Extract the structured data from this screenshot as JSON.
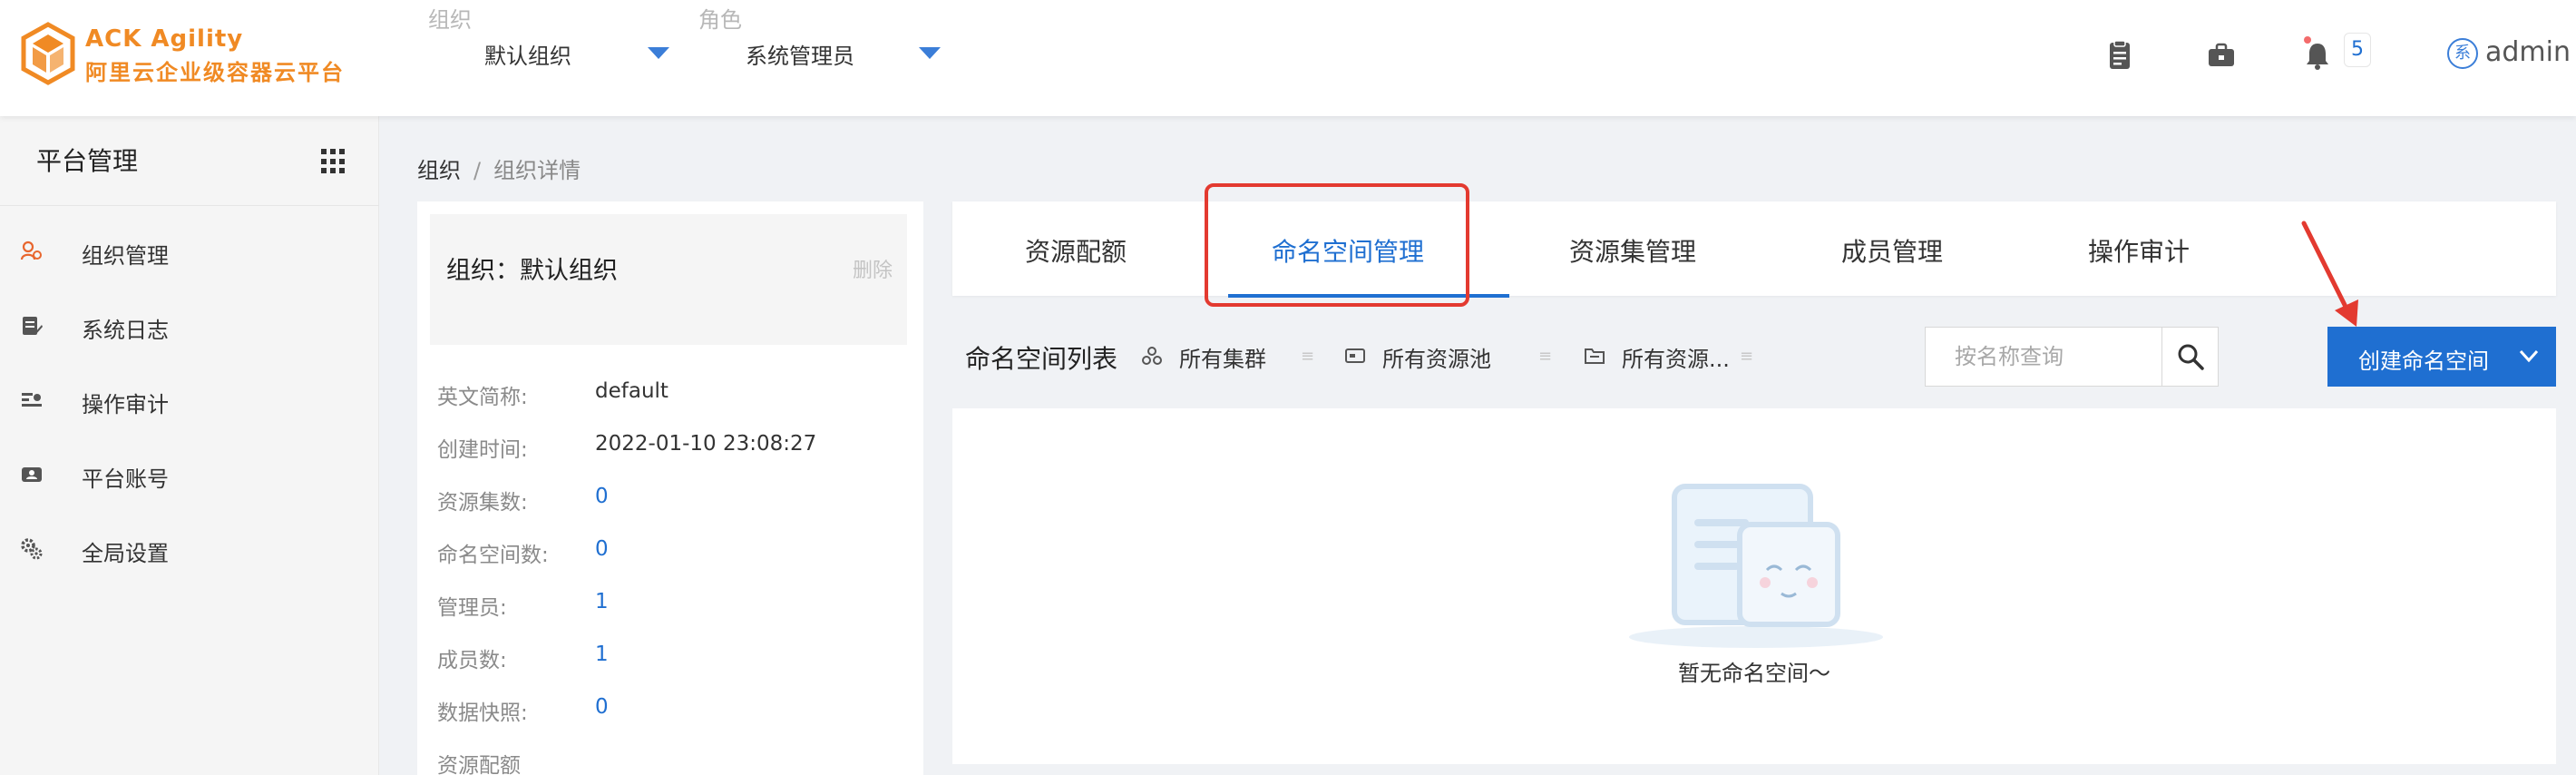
{
  "brand": {
    "name": "ACK  Agility",
    "subtitle": "阿里云企业级容器云平台",
    "accent_color": "#f08a24"
  },
  "header": {
    "org_selector": {
      "caption": "组织",
      "value": "默认组织"
    },
    "role_selector": {
      "caption": "角色",
      "value": "系统管理员"
    },
    "icons": [
      "clipboard-icon",
      "briefcase-icon",
      "bell-icon"
    ],
    "notification_count": "5",
    "user": {
      "avatar_text": "系",
      "name": "admin"
    }
  },
  "sidebar": {
    "title": "平台管理",
    "items": [
      {
        "label": "组织管理",
        "icon": "org-people-icon"
      },
      {
        "label": "系统日志",
        "icon": "log-icon"
      },
      {
        "label": "操作审计",
        "icon": "audit-icon"
      },
      {
        "label": "平台账号",
        "icon": "account-icon"
      },
      {
        "label": "全局设置",
        "icon": "settings-icon"
      }
    ]
  },
  "breadcrumb": {
    "root": "组织",
    "separator": "/",
    "current": "组织详情"
  },
  "org_info": {
    "title": "组织：默认组织",
    "delete_label": "删除",
    "fields": [
      {
        "key": "英文简称:",
        "value": "default",
        "highlight": false
      },
      {
        "key": "创建时间:",
        "value": "2022-01-10 23:08:27",
        "highlight": false
      },
      {
        "key": "资源集数:",
        "value": "0",
        "highlight": true
      },
      {
        "key": "命名空间数:",
        "value": "0",
        "highlight": true
      },
      {
        "key": "管理员:",
        "value": "1",
        "highlight": true
      },
      {
        "key": "成员数:",
        "value": "1",
        "highlight": true
      },
      {
        "key": "数据快照:",
        "value": "0",
        "highlight": true
      },
      {
        "key": "资源配额",
        "value": "",
        "highlight": false
      }
    ]
  },
  "tabs": [
    {
      "label": "资源配额",
      "active": false
    },
    {
      "label": "命名空间管理",
      "active": true
    },
    {
      "label": "资源集管理",
      "active": false
    },
    {
      "label": "成员管理",
      "active": false
    },
    {
      "label": "操作审计",
      "active": false
    }
  ],
  "list": {
    "title": "命名空间列表",
    "filters": [
      {
        "label": "所有集群",
        "icon": "cluster-icon"
      },
      {
        "label": "所有资源池",
        "icon": "resource-pool-icon"
      },
      {
        "label": "所有资源...",
        "icon": "folder-icon"
      }
    ],
    "search_placeholder": "按名称查询",
    "create_label": "创建命名空间",
    "empty_text": "暂无命名空间～"
  },
  "colors": {
    "primary": "#1f6fd1",
    "annotation": "#e33a30",
    "page_bg": "#f0f2f5"
  }
}
